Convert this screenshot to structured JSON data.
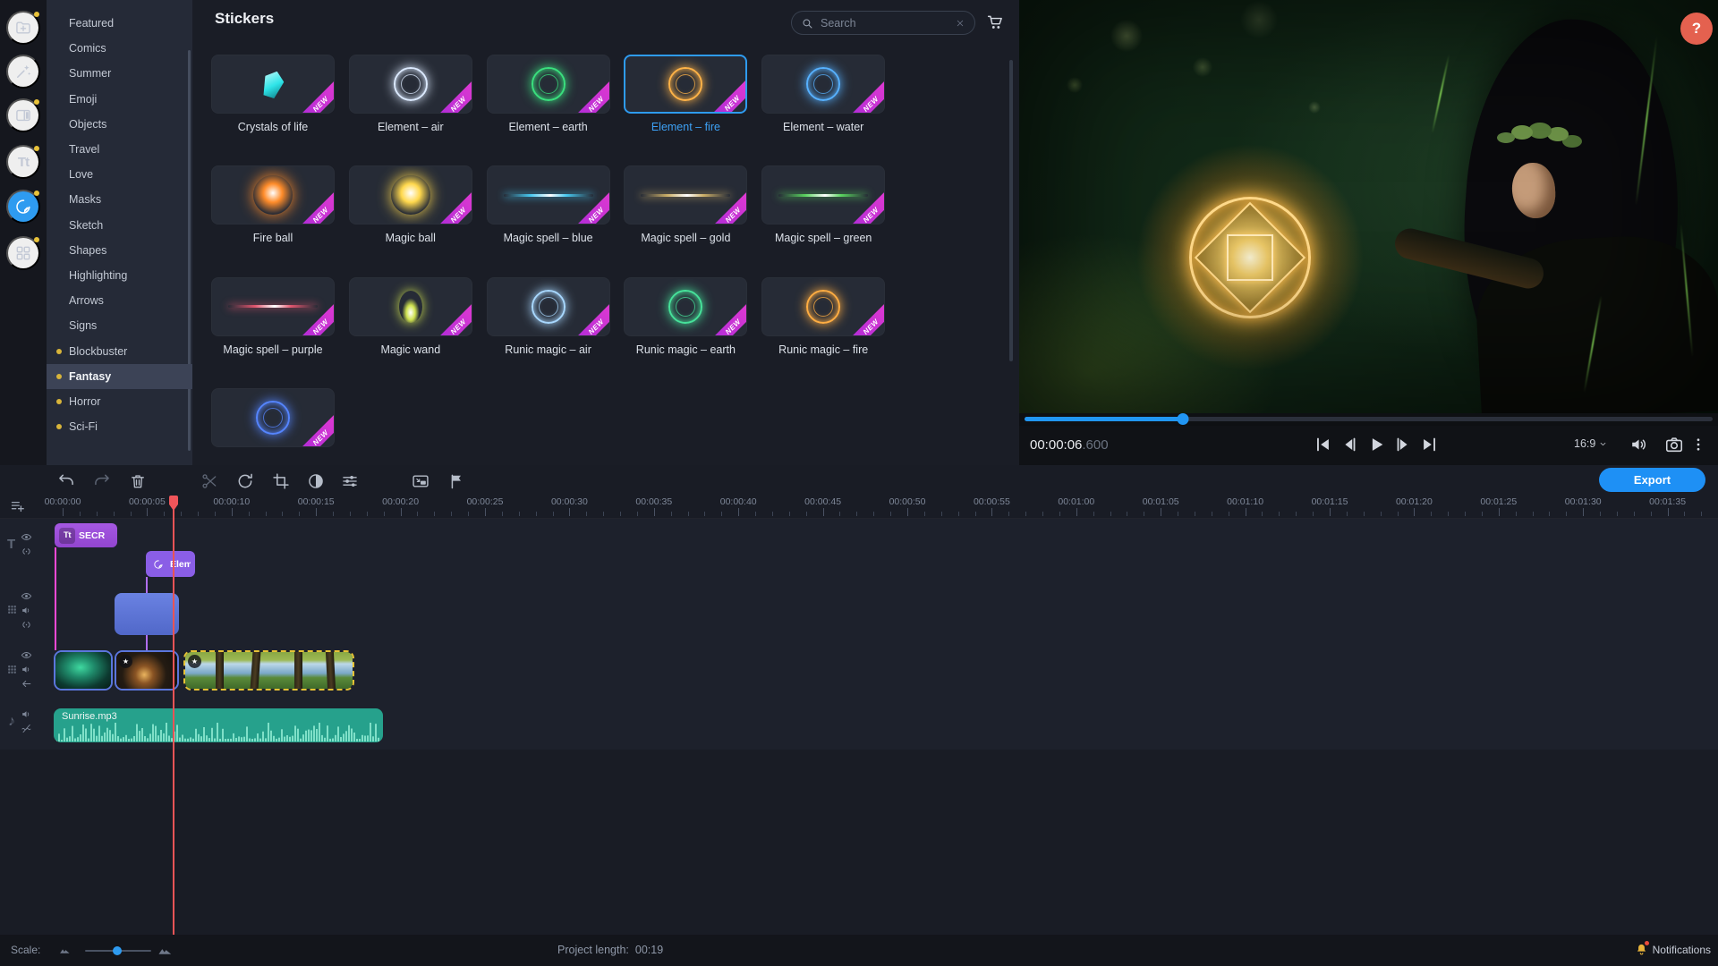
{
  "rail": {
    "items": [
      {
        "name": "import",
        "badge": true,
        "active": false
      },
      {
        "name": "filters",
        "badge": false,
        "active": false
      },
      {
        "name": "transitions",
        "badge": true,
        "active": false
      },
      {
        "name": "titles",
        "badge": true,
        "active": false
      },
      {
        "name": "stickers",
        "badge": true,
        "active": true
      },
      {
        "name": "more-tools",
        "badge": true,
        "active": false
      }
    ]
  },
  "categories": [
    {
      "label": "Featured"
    },
    {
      "label": "Comics"
    },
    {
      "label": "Summer"
    },
    {
      "label": "Emoji"
    },
    {
      "label": "Objects"
    },
    {
      "label": "Travel"
    },
    {
      "label": "Love"
    },
    {
      "label": "Masks"
    },
    {
      "label": "Sketch"
    },
    {
      "label": "Shapes"
    },
    {
      "label": "Highlighting"
    },
    {
      "label": "Arrows"
    },
    {
      "label": "Signs"
    },
    {
      "label": "Blockbuster",
      "dot": true
    },
    {
      "label": "Fantasy",
      "dot": true,
      "selected": true
    },
    {
      "label": "Horror",
      "dot": true
    },
    {
      "label": "Sci-Fi",
      "dot": true
    }
  ],
  "stickers": {
    "title": "Stickers",
    "search_placeholder": "Search",
    "badge_text": "NEW",
    "items": [
      {
        "label": "Crystals of life",
        "art": "crystal",
        "color": "#2ee4e8",
        "new": true
      },
      {
        "label": "Element – air",
        "art": "ring",
        "color": "#dceaff",
        "new": true
      },
      {
        "label": "Element – earth",
        "art": "ring",
        "color": "#3ae07e",
        "new": true
      },
      {
        "label": "Element – fire",
        "art": "ring",
        "color": "#ffb347",
        "new": true,
        "selected": true
      },
      {
        "label": "Element – water",
        "art": "ring",
        "color": "#57b1ff",
        "new": true
      },
      {
        "label": "Fire ball",
        "art": "ball",
        "color": "#ff8c2a",
        "new": true
      },
      {
        "label": "Magic ball",
        "art": "ball",
        "color": "#ffd84d",
        "new": true
      },
      {
        "label": "Magic spell – blue",
        "art": "streak",
        "color": "#47c9f0",
        "new": true
      },
      {
        "label": "Magic spell – gold",
        "art": "streak",
        "color": "#cdb069",
        "new": true
      },
      {
        "label": "Magic spell – green",
        "art": "streak",
        "color": "#5ad45f",
        "new": true
      },
      {
        "label": "Magic spell – purple",
        "art": "streak",
        "color": "#e0566e",
        "new": true
      },
      {
        "label": "Magic wand",
        "art": "burst",
        "color": "#cfe24f",
        "new": true
      },
      {
        "label": "Runic magic – air",
        "art": "ring",
        "color": "#a8d8ff",
        "new": true
      },
      {
        "label": "Runic magic – earth",
        "art": "ring",
        "color": "#46e29a",
        "new": true
      },
      {
        "label": "Runic magic – fire",
        "art": "ring",
        "color": "#ffad42",
        "new": true
      },
      {
        "label": "",
        "art": "ring",
        "color": "#5585ff",
        "new": true
      }
    ]
  },
  "preview": {
    "help": "?",
    "time": "00:00:06",
    "time_ms": ".600",
    "progress_pct": 23,
    "aspect": "16:9"
  },
  "toolbar": {
    "export": "Export"
  },
  "timeline": {
    "ruler_labels": [
      "00:00:00",
      "00:00:05",
      "00:00:10",
      "00:00:15",
      "00:00:20",
      "00:00:25",
      "00:00:30",
      "00:00:35",
      "00:00:40",
      "00:00:45",
      "00:00:50",
      "00:00:55",
      "00:01:00",
      "00:01:05",
      "00:01:10",
      "00:01:15",
      "00:01:20",
      "00:01:25",
      "00:01:30",
      "00:01:35"
    ],
    "clips": {
      "title": {
        "label": "SECR"
      },
      "sticker": {
        "label": "Elem"
      },
      "audio": {
        "label": "Sunrise.mp3"
      }
    }
  },
  "status": {
    "scale_label": "Scale:",
    "project_length_label": "Project length:",
    "project_length_value": "00:19",
    "notifications_label": "Notifications"
  }
}
